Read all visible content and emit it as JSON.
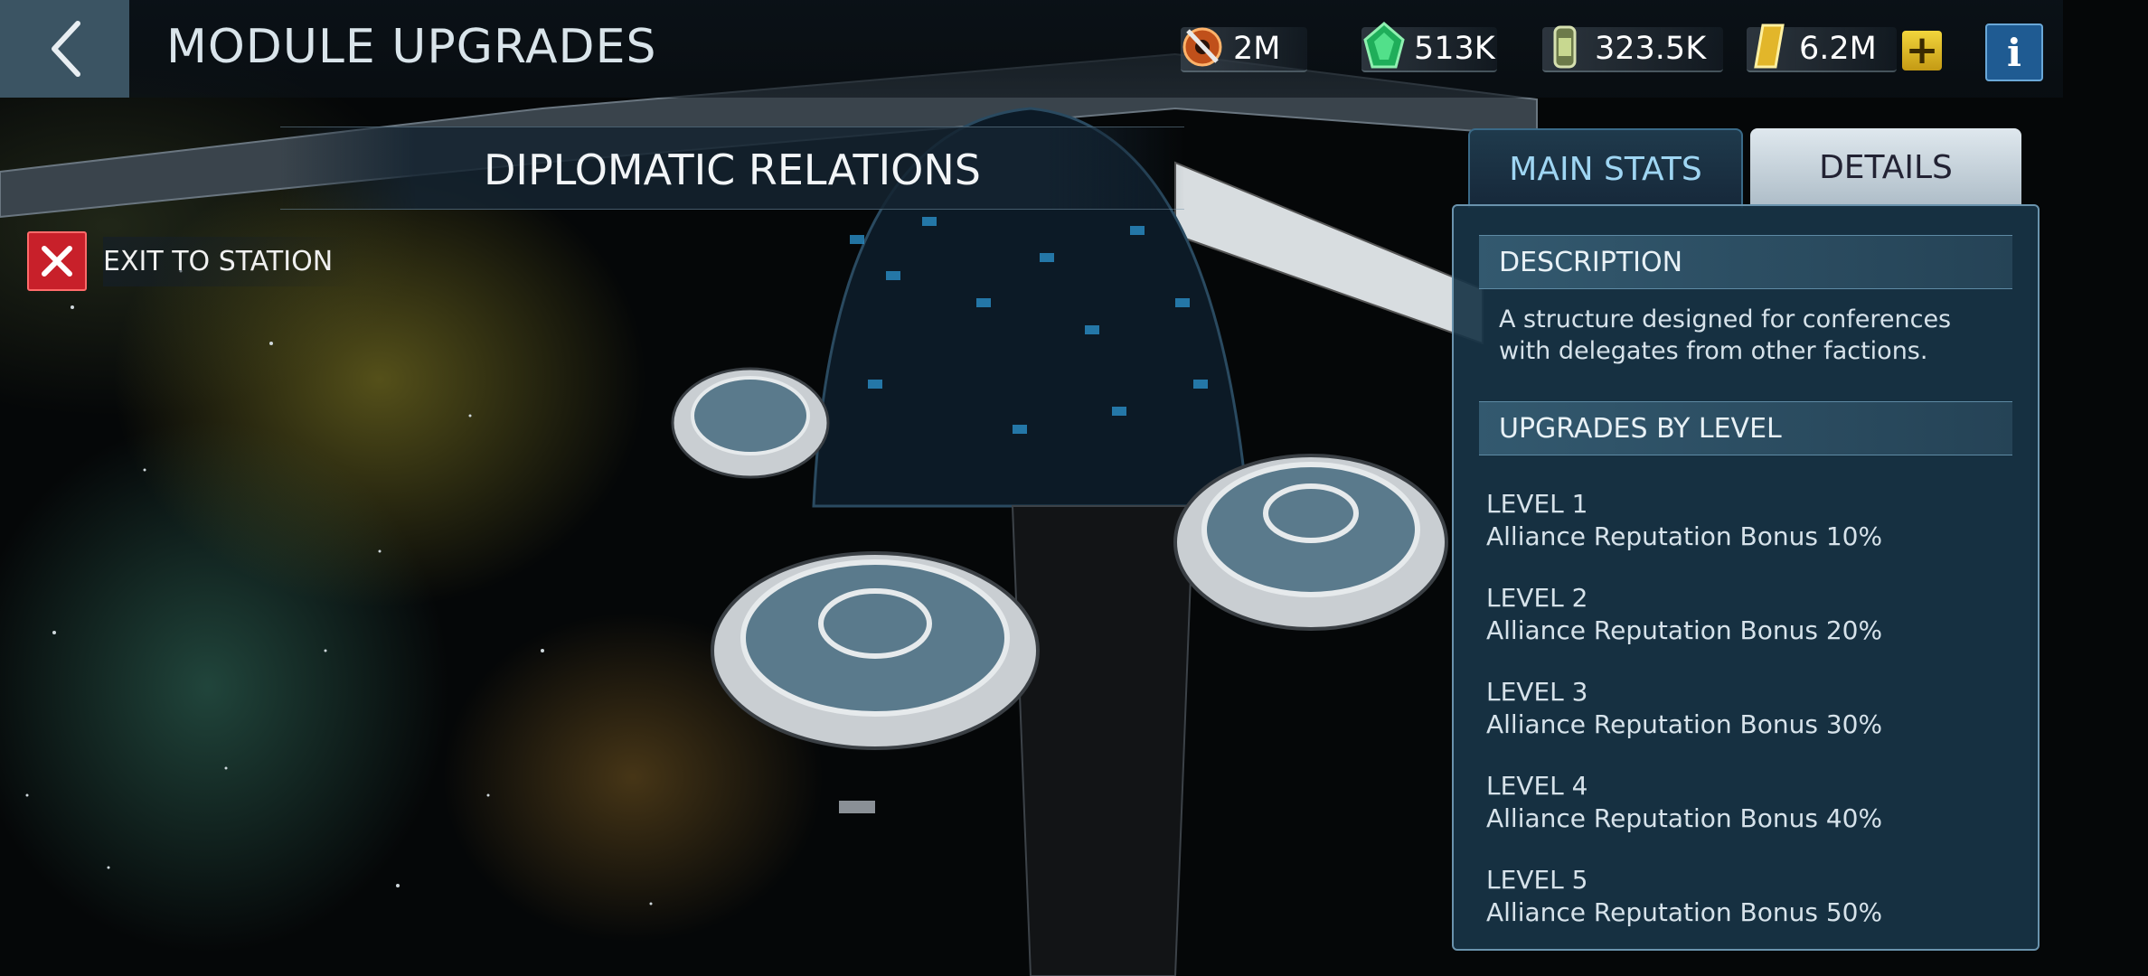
{
  "header": {
    "title": "MODULE UPGRADES",
    "resources": [
      {
        "icon": "parts-icon",
        "value": "2M"
      },
      {
        "icon": "crystal-icon",
        "value": "513K"
      },
      {
        "icon": "gas-icon",
        "value": "323.5K"
      },
      {
        "icon": "latinum-icon",
        "value": "6.2M"
      }
    ]
  },
  "module": {
    "name": "DIPLOMATIC RELATIONS",
    "exit_label": "EXIT TO STATION"
  },
  "tabs": [
    {
      "label": "MAIN STATS",
      "active": false
    },
    {
      "label": "DETAILS",
      "active": true
    }
  ],
  "details": {
    "description_heading": "DESCRIPTION",
    "description": "A structure designed for conferences with delegates from other factions.",
    "upgrades_heading": "UPGRADES BY LEVEL",
    "levels": [
      {
        "title": "LEVEL 1",
        "bonus": "Alliance Reputation Bonus 10%"
      },
      {
        "title": "LEVEL 2",
        "bonus": "Alliance Reputation Bonus 20%"
      },
      {
        "title": "LEVEL 3",
        "bonus": "Alliance Reputation Bonus 30%"
      },
      {
        "title": "LEVEL 4",
        "bonus": "Alliance Reputation Bonus 40%"
      },
      {
        "title": "LEVEL 5",
        "bonus": "Alliance Reputation Bonus 50%"
      }
    ]
  },
  "colors": {
    "exit_red": "#c8202a",
    "info_blue": "#1f5b92",
    "plus_gold": "#f2d53c",
    "panel_bg": "#18344a"
  }
}
